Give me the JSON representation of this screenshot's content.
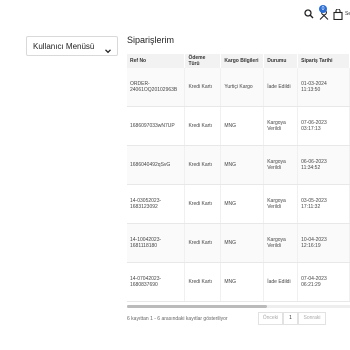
{
  "header": {
    "cart_badge": "0",
    "cart_label": "Se"
  },
  "sidebar": {
    "menu_label": "Kullanıcı Menüsü"
  },
  "orders": {
    "title": "Siparişlerim",
    "columns": [
      "Ref No",
      "Ödeme Türü",
      "Kargo Bilgileri",
      "Durumu",
      "Sipariş Tarihi"
    ],
    "rows": [
      [
        "ORDER-24061OQ20102963B",
        "Kredi Kartı",
        "Yurtiçi Kargo",
        "İade Edildi",
        "01-03-2024 11:13:50"
      ],
      [
        "1686097033wN7UP",
        "Kredi Kartı",
        "MNG",
        "Kargoya Verildi",
        "07-06-2023 03:17:13"
      ],
      [
        "1686040492qSvG",
        "Kredi Kartı",
        "MNG",
        "Kargoya Verildi",
        "06-06-2023 11:34:52"
      ],
      [
        "14-03052023-1683123092",
        "Kredi Kartı",
        "MNG",
        "Kargoya Verildi",
        "03-05-2023 17:11:32"
      ],
      [
        "14-10042023-1681118180",
        "Kredi Kartı",
        "MNG",
        "Kargoya Verildi",
        "10-04-2023 12:16:19"
      ],
      [
        "14-07042023-1680837690",
        "Kredi Kartı",
        "MNG",
        "İade Edildi",
        "07-04-2023 06:21:29"
      ]
    ]
  },
  "pagination": {
    "info": "6 kayıttan 1 - 6 arasındaki kayıtlar gösteriliyor",
    "prev_label": "Önceki",
    "current_page": "1",
    "next_label": "Sonraki"
  }
}
